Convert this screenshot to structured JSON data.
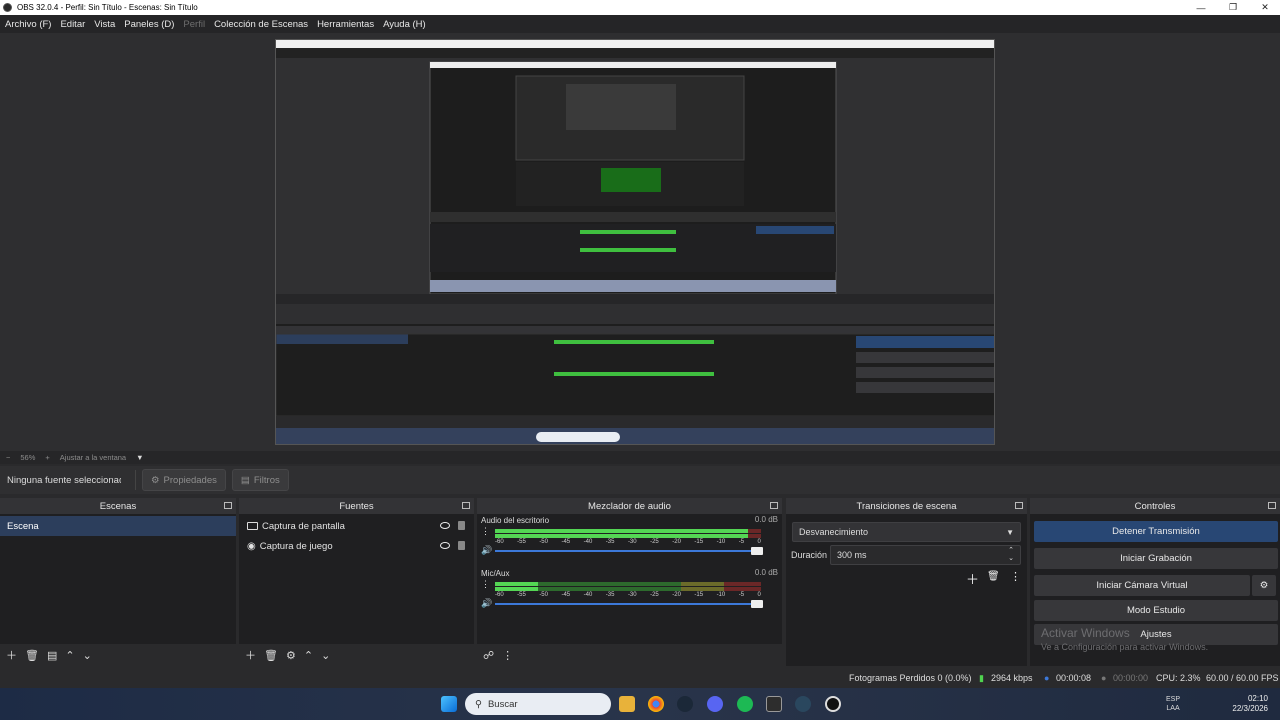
{
  "window": {
    "title": "OBS 32.0.4 - Perfil: Sin Título - Escenas: Sin Título"
  },
  "menu": [
    "Archivo (F)",
    "Editar",
    "Vista",
    "Paneles (D)",
    "Perfil",
    "Colección de Escenas",
    "Herramientas",
    "Ayuda (H)"
  ],
  "zoom": {
    "minus": "−",
    "value": "56%",
    "plus": "+",
    "fit": "Ajustar a la ventana",
    "dropdown": "▼"
  },
  "context": {
    "no_source": "Ninguna fuente seleccionada",
    "properties": "Propiedades",
    "filters": "Filtros"
  },
  "docks": {
    "scenes": {
      "title": "Escenas",
      "items": [
        "Escena"
      ]
    },
    "sources": {
      "title": "Fuentes",
      "items": [
        "Captura de pantalla",
        "Captura de juego"
      ]
    },
    "mixer": {
      "title": "Mezclador de audio",
      "tracks": [
        {
          "name": "Audio del escritorio",
          "db": "0.0 dB",
          "level": 0.95
        },
        {
          "name": "Mic/Aux",
          "db": "0.0 dB",
          "level": 0.16
        }
      ],
      "ticks": [
        "-60",
        "-55",
        "-50",
        "-45",
        "-40",
        "-35",
        "-30",
        "-25",
        "-20",
        "-15",
        "-10",
        "-5",
        "0"
      ]
    },
    "transitions": {
      "title": "Transiciones de escena",
      "selected": "Desvanecimiento",
      "duration_label": "Duración",
      "duration_value": "300 ms"
    },
    "controls": {
      "title": "Controles",
      "stop_stream": "Detener Transmisión",
      "start_recording": "Iniciar Grabación",
      "virtual_camera": "Iniciar Cámara Virtual",
      "studio_mode": "Modo Estudio",
      "settings": "Ajustes"
    }
  },
  "watermark": {
    "title": "Activar Windows",
    "subtitle": "Ve a Configuración para activar Windows."
  },
  "status": {
    "dropped": "Fotogramas Perdidos 0 (0.0%)",
    "bitrate": "2964 kbps",
    "stream_time": "00:00:08",
    "rec_time": "00:00:00",
    "cpu": "CPU: 2.3%",
    "fps": "60.00 / 60.00 FPS"
  },
  "taskbar": {
    "search": "Buscar",
    "lang1": "ESP",
    "lang2": "LAA",
    "time": "02:10",
    "date": "22/3/2026"
  },
  "colors": {
    "accent": "#284774",
    "scene_selected": "#2c3e5c",
    "meter_green": "#54d654",
    "fader": "#3c78d8"
  }
}
